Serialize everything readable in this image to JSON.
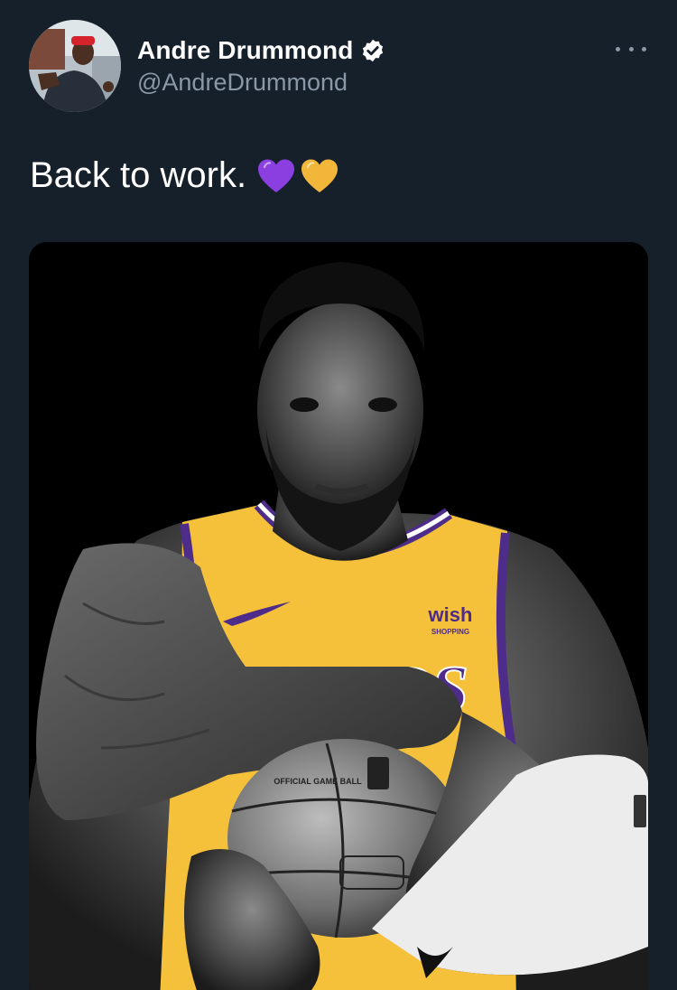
{
  "tweet": {
    "author": {
      "display_name": "Andre Drummond",
      "handle": "@AndreDrummond",
      "verified": true,
      "avatar_icon": "profile-photo"
    },
    "text": "Back to work.",
    "emojis": [
      "purple-heart",
      "yellow-heart"
    ],
    "more_icon": "more-horizontal-icon"
  },
  "media": {
    "jersey_team": "LAKERS",
    "jersey_sponsor": "wish",
    "jersey_sponsor_sub": "SHOPPING",
    "ball_label": "OFFICIAL GAME BALL"
  },
  "colors": {
    "background": "#15202b",
    "text_primary": "#ffffff",
    "text_secondary": "#8b98a5",
    "purple_heart": "#8b3fe0",
    "yellow_heart": "#f2b63a",
    "lakers_gold": "#f5c13b",
    "lakers_purple": "#4d2c8a"
  }
}
